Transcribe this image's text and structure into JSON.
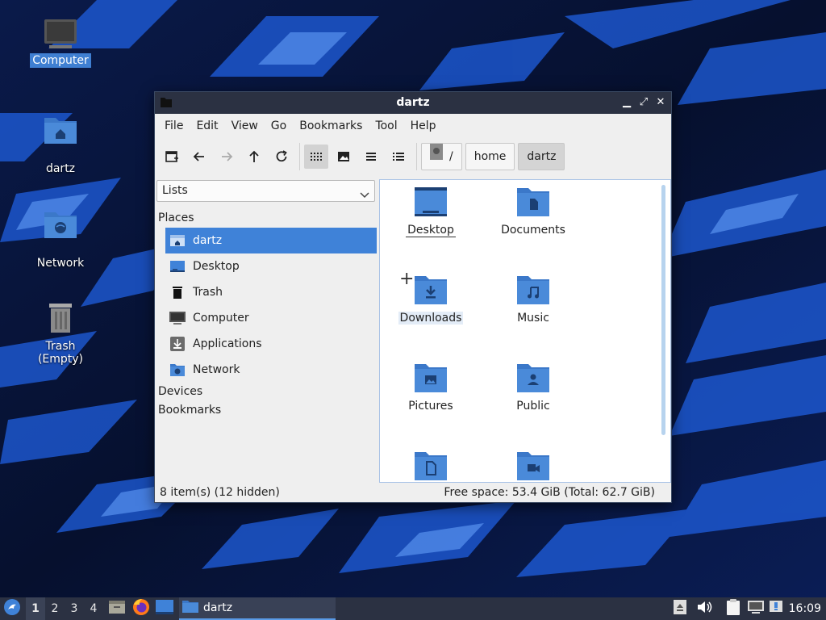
{
  "desktop": {
    "icons": [
      {
        "label": "Computer",
        "icon": "computer-icon",
        "selected": true
      },
      {
        "label": "dartz",
        "icon": "home-folder-icon"
      },
      {
        "label": "Network",
        "icon": "network-folder-icon"
      },
      {
        "label": "Trash (Empty)",
        "icon": "trash-icon"
      }
    ]
  },
  "window": {
    "title": "dartz",
    "controls": {
      "minimize": "minimize-icon",
      "maximize": "maximize-icon",
      "close": "close-icon"
    },
    "menu": [
      "File",
      "Edit",
      "View",
      "Go",
      "Bookmarks",
      "Tool",
      "Help"
    ],
    "toolbar": {
      "buttons": [
        "new-tab-icon",
        "back-icon",
        "forward-icon",
        "up-icon",
        "reload-icon",
        "icon-view-icon",
        "thumbnail-view-icon",
        "compact-view-icon",
        "detailed-list-icon"
      ],
      "active_view": "icon-view-icon",
      "path": [
        {
          "label": "/",
          "icon": "drive-icon"
        },
        {
          "label": "home"
        },
        {
          "label": "dartz",
          "current": true
        }
      ]
    },
    "side_panel": {
      "mode": "Lists",
      "sections": {
        "places": "Places",
        "devices": "Devices",
        "bookmarks": "Bookmarks"
      },
      "places": [
        {
          "label": "dartz",
          "icon": "home-folder-icon",
          "selected": true
        },
        {
          "label": "Desktop",
          "icon": "desktop-icon"
        },
        {
          "label": "Trash",
          "icon": "trash-icon"
        },
        {
          "label": "Computer",
          "icon": "computer-icon"
        },
        {
          "label": "Applications",
          "icon": "applications-icon"
        },
        {
          "label": "Network",
          "icon": "network-folder-icon"
        }
      ]
    },
    "files": [
      {
        "label": "Desktop",
        "icon": "desktop-folder-icon",
        "focused": true
      },
      {
        "label": "Documents",
        "icon": "documents-folder-icon"
      },
      {
        "label": "Downloads",
        "icon": "downloads-folder-icon",
        "hover": true
      },
      {
        "label": "Music",
        "icon": "music-folder-icon"
      },
      {
        "label": "Pictures",
        "icon": "pictures-folder-icon"
      },
      {
        "label": "Public",
        "icon": "public-folder-icon"
      },
      {
        "label": "",
        "icon": "templates-folder-icon"
      },
      {
        "label": "",
        "icon": "videos-folder-icon"
      }
    ],
    "status": {
      "items": "8 item(s) (12 hidden)",
      "free_space": "Free space: 53.4 GiB (Total: 62.7 GiB)"
    }
  },
  "taskbar": {
    "workspaces": [
      "1",
      "2",
      "3",
      "4"
    ],
    "active_workspace": "1",
    "launchers": [
      "start-menu-icon",
      "file-manager-icon",
      "firefox-icon",
      "show-desktop-icon"
    ],
    "tasks": [
      {
        "label": "dartz",
        "icon": "folder-icon"
      }
    ],
    "tray": [
      "eject-icon",
      "volume-icon",
      "clipboard-icon",
      "network-tray-icon",
      "update-notifier-icon"
    ],
    "clock": "16:09"
  },
  "colors": {
    "accent": "#3f82d8",
    "folder": "#4a8ad9",
    "titlebar": "#2b3142"
  }
}
